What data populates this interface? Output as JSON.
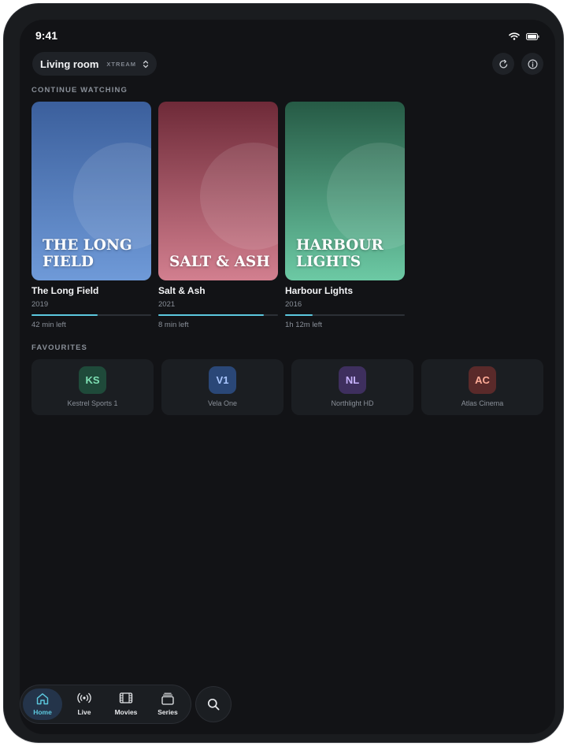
{
  "status_bar": {
    "time": "9:41",
    "icons": [
      "wifi-icon",
      "battery-icon"
    ]
  },
  "header": {
    "profile_name": "Living room",
    "profile_badge": "XTREAM",
    "actions": [
      "refresh-icon",
      "info-icon"
    ]
  },
  "continue_watching": {
    "label": "CONTINUE WATCHING",
    "items": [
      {
        "poster_title": "The Long Field",
        "title": "The Long Field",
        "year": "2019",
        "progress": 0.55,
        "time_left": "42 min left",
        "colors": [
          "#3b5f9c",
          "#6f9ad8"
        ]
      },
      {
        "poster_title": "Salt & Ash",
        "title": "Salt & Ash",
        "year": "2021",
        "progress": 0.88,
        "time_left": "8 min left",
        "colors": [
          "#6e2a38",
          "#d27f8f"
        ]
      },
      {
        "poster_title": "Harbour Lights",
        "title": "Harbour Lights",
        "year": "2016",
        "progress": 0.23,
        "time_left": "1h 12m left",
        "colors": [
          "#265a45",
          "#6cc9a4"
        ]
      }
    ]
  },
  "favourites": {
    "label": "FAVOURITES",
    "items": [
      {
        "initials": "KS",
        "name": "Kestrel Sports 1",
        "bg": "#1f4a3a",
        "fg": "#7fe0b4"
      },
      {
        "initials": "V1",
        "name": "Vela One",
        "bg": "#2a4777",
        "fg": "#a9c6ff"
      },
      {
        "initials": "NL",
        "name": "Northlight HD",
        "bg": "#3e2f5e",
        "fg": "#c7b2ff"
      },
      {
        "initials": "AC",
        "name": "Atlas Cinema",
        "bg": "#5a2a2a",
        "fg": "#ffac98"
      }
    ]
  },
  "tab_bar": {
    "active": "Home",
    "accent": "#5cc8de",
    "tabs": [
      {
        "label": "Home",
        "icon": "home-icon"
      },
      {
        "label": "Live",
        "icon": "broadcast-icon"
      },
      {
        "label": "Movies",
        "icon": "film-icon"
      },
      {
        "label": "Series",
        "icon": "stack-icon"
      }
    ],
    "search_icon": "search-icon"
  }
}
